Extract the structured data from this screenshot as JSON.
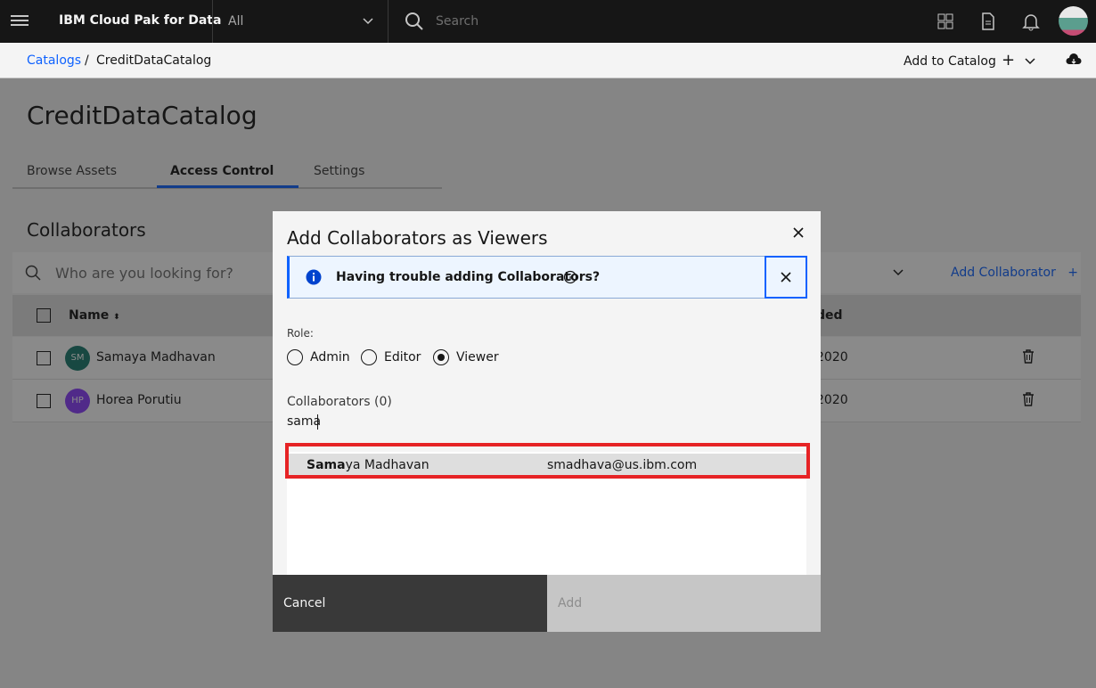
{
  "header": {
    "brand": "IBM Cloud Pak for Data",
    "scope_value": "All",
    "search_placeholder": "Search"
  },
  "breadcrumb": {
    "root": "Catalogs",
    "separator": "/",
    "current": "CreditDataCatalog"
  },
  "actions": {
    "add_to_catalog": "Add to Catalog",
    "plus": "+"
  },
  "page": {
    "title": "CreditDataCatalog",
    "tabs": [
      "Browse Assets",
      "Access Control",
      "Settings"
    ],
    "active_tab": "Access Control",
    "section_title": "Collaborators",
    "search_placeholder": "Who are you looking for?",
    "add_collaborator": "Add Collaborator",
    "add_plus": "+"
  },
  "table": {
    "col_name": "Name",
    "col_added": "ded",
    "rows": [
      {
        "initials": "SM",
        "name": "Samaya Madhavan",
        "date": "2020",
        "avatar_color": "#1a7a6e"
      },
      {
        "initials": "HP",
        "name": "Horea Porutiu",
        "date": "2020",
        "avatar_color": "#8a3ffc"
      }
    ]
  },
  "modal": {
    "title": "Add Collaborators as Viewers",
    "notification": "Having trouble adding Collaborators?",
    "role_label": "Role:",
    "roles": [
      "Admin",
      "Editor",
      "Viewer"
    ],
    "selected_role": "Viewer",
    "collaborators_label": "Collaborators (0)",
    "input_value": "sama",
    "suggestion": {
      "name_match": "Sama",
      "name_rest": "ya Madhavan",
      "email": "smadhava@us.ibm.com"
    },
    "cancel": "Cancel",
    "add": "Add"
  },
  "colors": {
    "accent": "#0f62fe",
    "highlight": "#e62325"
  }
}
